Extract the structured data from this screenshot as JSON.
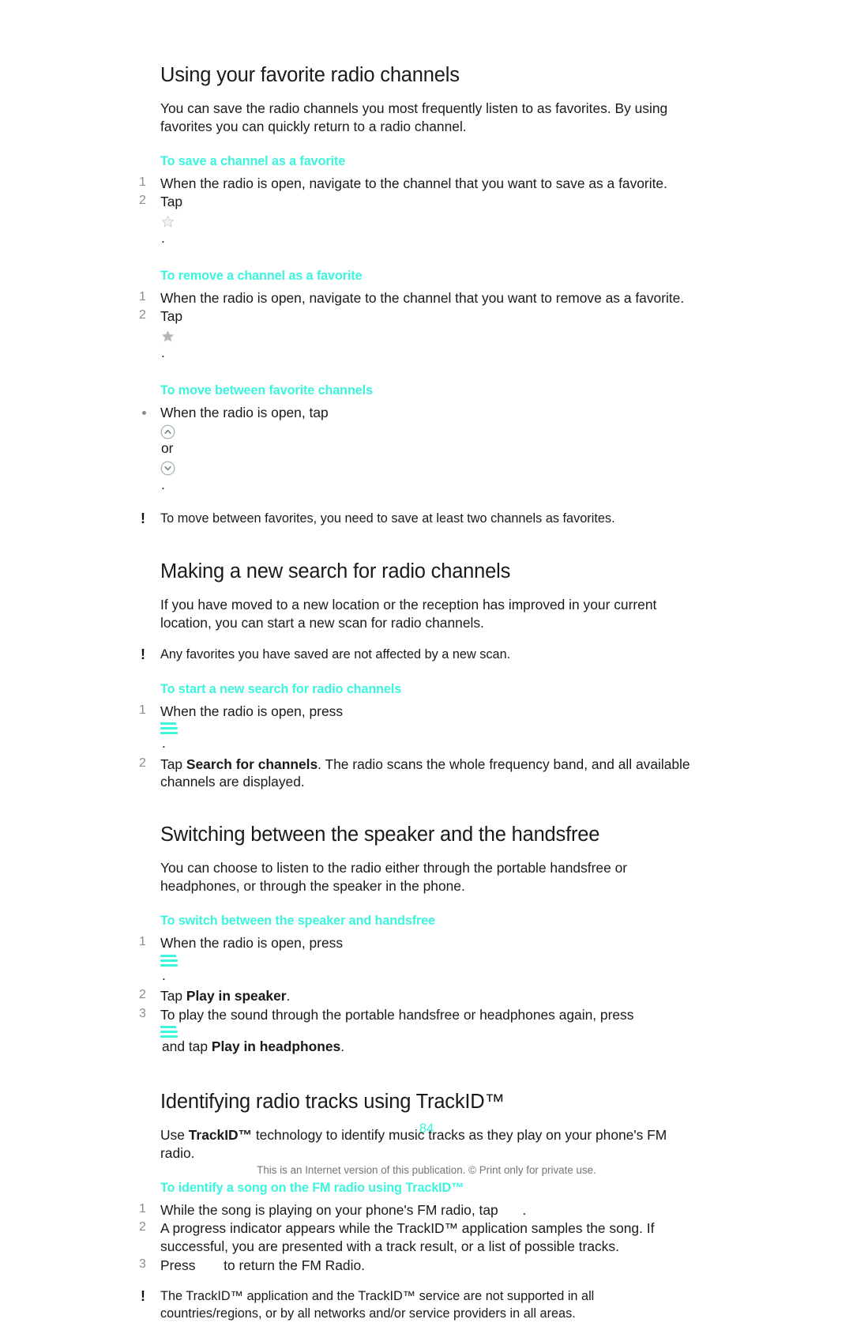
{
  "document": {
    "page_number": "84",
    "footer": "This is an Internet version of this publication. © Print only for private use."
  },
  "sections": [
    {
      "title": "Using your favorite radio channels",
      "intro": "You can save the radio channels you most frequently listen to as favorites. By using favorites you can quickly return to a radio channel.",
      "sub1": {
        "heading": "To save a channel as a favorite",
        "step1_marker": "1",
        "step1": "When the radio is open, navigate to the channel that you want to save as a favorite.",
        "step2_marker": "2",
        "step2_pre": "Tap ",
        "step2_post": "."
      },
      "sub2": {
        "heading": "To remove a channel as a favorite",
        "step1_marker": "1",
        "step1": "When the radio is open, navigate to the channel that you want to remove as a favorite.",
        "step2_marker": "2",
        "step2_pre": "Tap ",
        "step2_post": "."
      },
      "sub3": {
        "heading": "To move between favorite channels",
        "step1_pre": "When the radio is open, tap ",
        "step1_mid": " or ",
        "step1_post": "."
      },
      "note": "To move between favorites, you need to save at least two channels as favorites."
    },
    {
      "title": "Making a new search for radio channels",
      "intro": "If you have moved to a new location or the reception has improved in your current location, you can start a new scan for radio channels.",
      "note": "Any favorites you have saved are not affected by a new scan.",
      "sub1": {
        "heading": "To start a new search for radio channels",
        "step1_marker": "1",
        "step1_pre": "When the radio is open, press ",
        "step1_post": ".",
        "step2_marker": "2",
        "step2_pre": "Tap ",
        "step2_bold": "Search for channels",
        "step2_post": ". The radio scans the whole frequency band, and all available channels are displayed."
      }
    },
    {
      "title": "Switching between the speaker and the handsfree",
      "intro": "You can choose to listen to the radio either through the portable handsfree or headphones, or through the speaker in the phone.",
      "sub1": {
        "heading": "To switch between the speaker and handsfree",
        "step1_marker": "1",
        "step1_pre": "When the radio is open, press ",
        "step1_post": ".",
        "step2_marker": "2",
        "step2_pre": "Tap ",
        "step2_bold": "Play in speaker",
        "step2_post": ".",
        "step3_marker": "3",
        "step3_pre": "To play the sound through the portable handsfree or headphones again, press ",
        "step3_mid": " and tap ",
        "step3_bold": "Play in headphones",
        "step3_post": "."
      }
    },
    {
      "title": "Identifying radio tracks using TrackID™",
      "intro_pre": "Use ",
      "intro_bold": "TrackID™",
      "intro_post": " technology to identify music tracks as they play on your phone's FM radio.",
      "sub1": {
        "heading": "To identify a song on the FM radio using TrackID™",
        "step1_marker": "1",
        "step1_pre": "While the song is playing on your phone's FM radio, tap ",
        "step1_post": ".",
        "step2_marker": "2",
        "step2": "A progress indicator appears while the TrackID™ application samples the song. If successful, you are presented with a track result, or a list of possible tracks.",
        "step3_marker": "3",
        "step3_pre": "Press ",
        "step3_post": " to return the FM Radio."
      },
      "note": "The TrackID™ application and the TrackID™ service are not supported in all countries/regions, or by all networks and/or service providers in all areas."
    }
  ],
  "colors": {
    "accent_cyan": "#3cf5dd",
    "body_text": "#1a1a1a",
    "marker_grey": "#8c8c8c",
    "footer_grey": "#757575"
  },
  "icons": {
    "star_filled": "star-filled-icon",
    "star_empty": "star-empty-icon",
    "chevron_up": "chevron-up-circle-icon",
    "chevron_down": "chevron-down-circle-icon",
    "menu": "menu-icon"
  }
}
